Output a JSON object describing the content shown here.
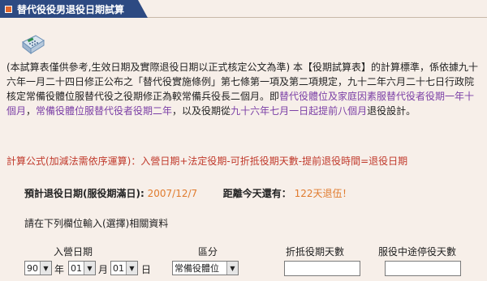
{
  "header": {
    "title": "替代役役男退役日期試算"
  },
  "intro": {
    "p1": "(本試算表僅供參考,生效日期及實際退役日期以正式核定公文為準)",
    "p2": "本【役期試算表】的計算標準，係依據九十六年一月二十四日修正公布之「替代役實施條例」第七條第一項及第二項規定，九十二年六月二十七日行政院核定常備役體位服替代役之役期修正為較常備兵役長二個月。即",
    "p3": "替代役體位及家庭因素服替代役者役期一年十個月",
    "p4": "，",
    "p5": "常備役體位服替代役者役期二年",
    "p6": "，以及役期從",
    "p7": "九十六年七月一日起提前八個月",
    "p8": "退役設計。"
  },
  "formula": "計算公式(加減法需依序運算)：入營日期+法定役期-可折抵役期天數-提前退役時間=退役日期",
  "prediction": {
    "label": "預計退役日期(服役期滿日):",
    "date": "2007/12/7",
    "remaining_label": "距離今天還有：",
    "remaining": "122天退伍！"
  },
  "prompt": "請在下列欄位輸入(選擇)相關資料",
  "form": {
    "col_enlist": "入營日期",
    "col_category": "區分",
    "col_offset_days": "折抵役期天數",
    "col_pause_days": "服役中途停役天數",
    "year_value": "90",
    "year_unit": "年",
    "month_value": "01",
    "month_unit": "月",
    "day_value": "01",
    "day_unit": "日",
    "category_value": "常備役體位",
    "offset_days_value": "",
    "pause_days_value": ""
  },
  "icons": {
    "calculator": "calculator-icon",
    "dropdown": "chevron-down-icon"
  }
}
